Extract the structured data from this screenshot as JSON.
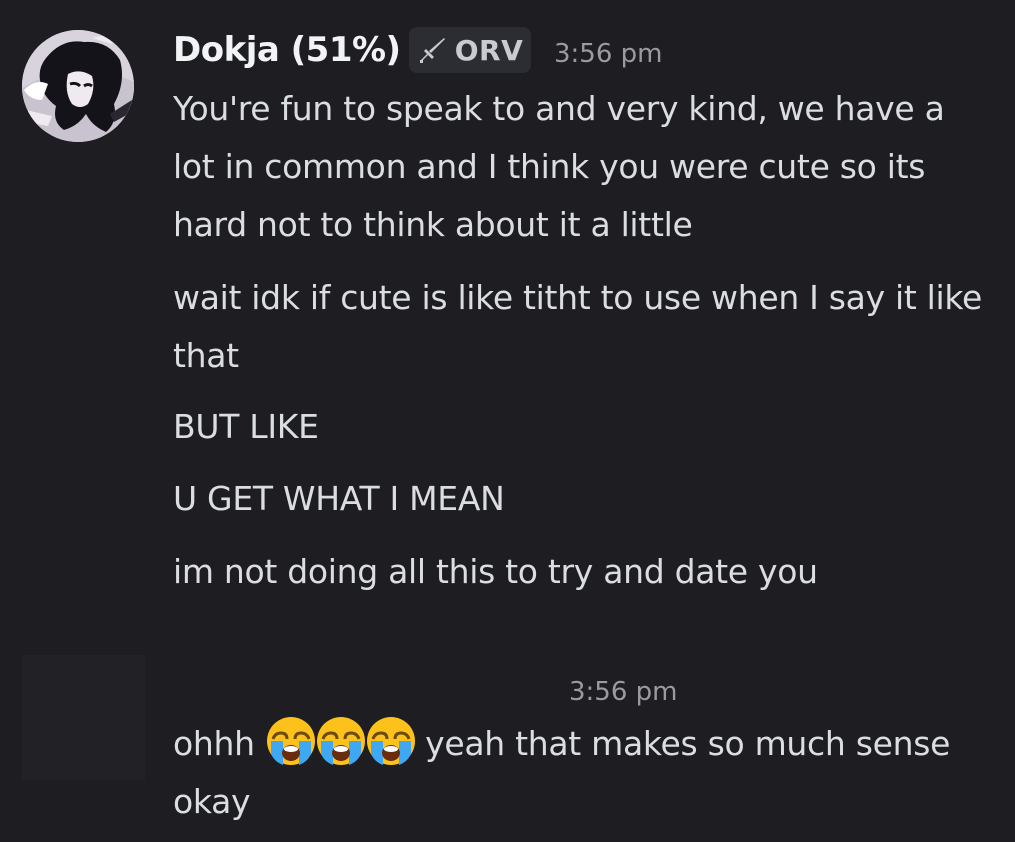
{
  "message_group": {
    "author": "Dokja (51%)",
    "tag": {
      "icon": "sword-icon",
      "label": "ORV"
    },
    "timestamp": "3:56 pm",
    "messages": [
      "You're fun to speak to and very kind, we have a lot in common and I think you were cute so its hard not to think about it a little",
      "wait idk if cute is like titht to use when I say it like that",
      "BUT LIKE",
      "U GET WHAT I MEAN",
      "im not doing all this to try and date you"
    ]
  },
  "reply": {
    "timestamp": "3:56 pm",
    "text_before": "ohhh",
    "emojis": [
      "loudly-crying-face",
      "loudly-crying-face",
      "loudly-crying-face"
    ],
    "text_after": "yeah that makes so much sense okay"
  },
  "colors": {
    "background": "#1d1d22",
    "username": "#f2f3f5",
    "message_text": "#dbdee1",
    "timestamp": "#999ba1",
    "tag_background": "#2c2d33"
  }
}
